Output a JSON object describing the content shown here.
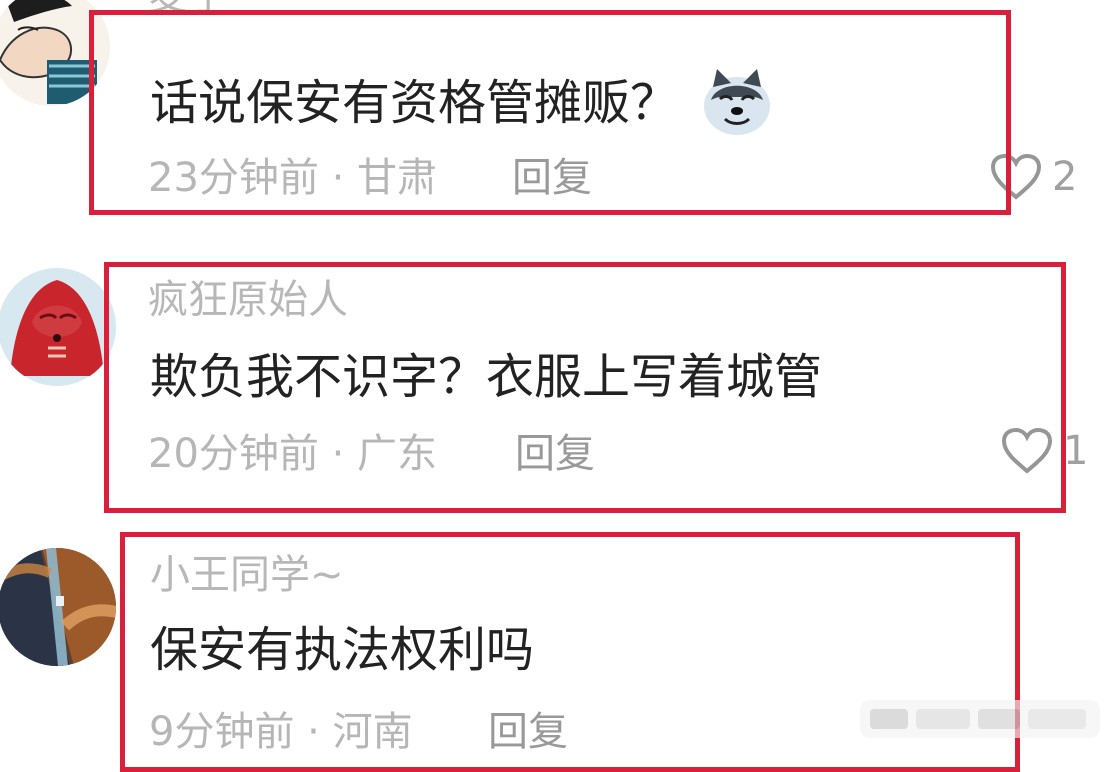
{
  "comments": [
    {
      "username": "麦子",
      "text": "话说保安有资格管摊贩？",
      "meta": "23分钟前 · 甘肃",
      "reply": "回复",
      "likes": "2",
      "emoji": "husky-dog-sticker"
    },
    {
      "username": "疯狂原始人",
      "text": "欺负我不识字？衣服上写着城管",
      "meta": "20分钟前 · 广东",
      "reply": "回复",
      "likes": "1"
    },
    {
      "username": "小王同学~",
      "text": "保安有执法权利吗",
      "meta": "9分钟前 · 河南",
      "reply": "回复",
      "likes": ""
    }
  ],
  "colors": {
    "highlight": "#d91f3a",
    "username": "#b7b7b7",
    "content": "#222222",
    "meta": "#b6b6b6"
  },
  "icons": {
    "like": "heart-outline-icon"
  }
}
